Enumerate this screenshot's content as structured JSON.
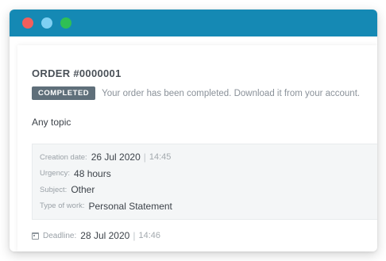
{
  "window": {
    "colors": {
      "titlebar": "#1589b4",
      "close": "#f25f5c",
      "minimize": "#7fd0f3",
      "maximize": "#2fbf55"
    }
  },
  "order": {
    "title": "ORDER #0000001",
    "status_badge": "COMPLETED",
    "status_message": "Your order has been completed. Download it from your account.",
    "topic": "Any topic"
  },
  "details": {
    "creation_label": "Creation date:",
    "creation_date": "26 Jul 2020",
    "creation_time": "14:45",
    "urgency_label": "Urgency:",
    "urgency_value": "48 hours",
    "subject_label": "Subject:",
    "subject_value": "Other",
    "type_label": "Type of work:",
    "type_value": "Personal Statement"
  },
  "deadline": {
    "icon": "calendar-icon",
    "label": "Deadline:",
    "date": "28 Jul 2020",
    "time": "14:46"
  }
}
